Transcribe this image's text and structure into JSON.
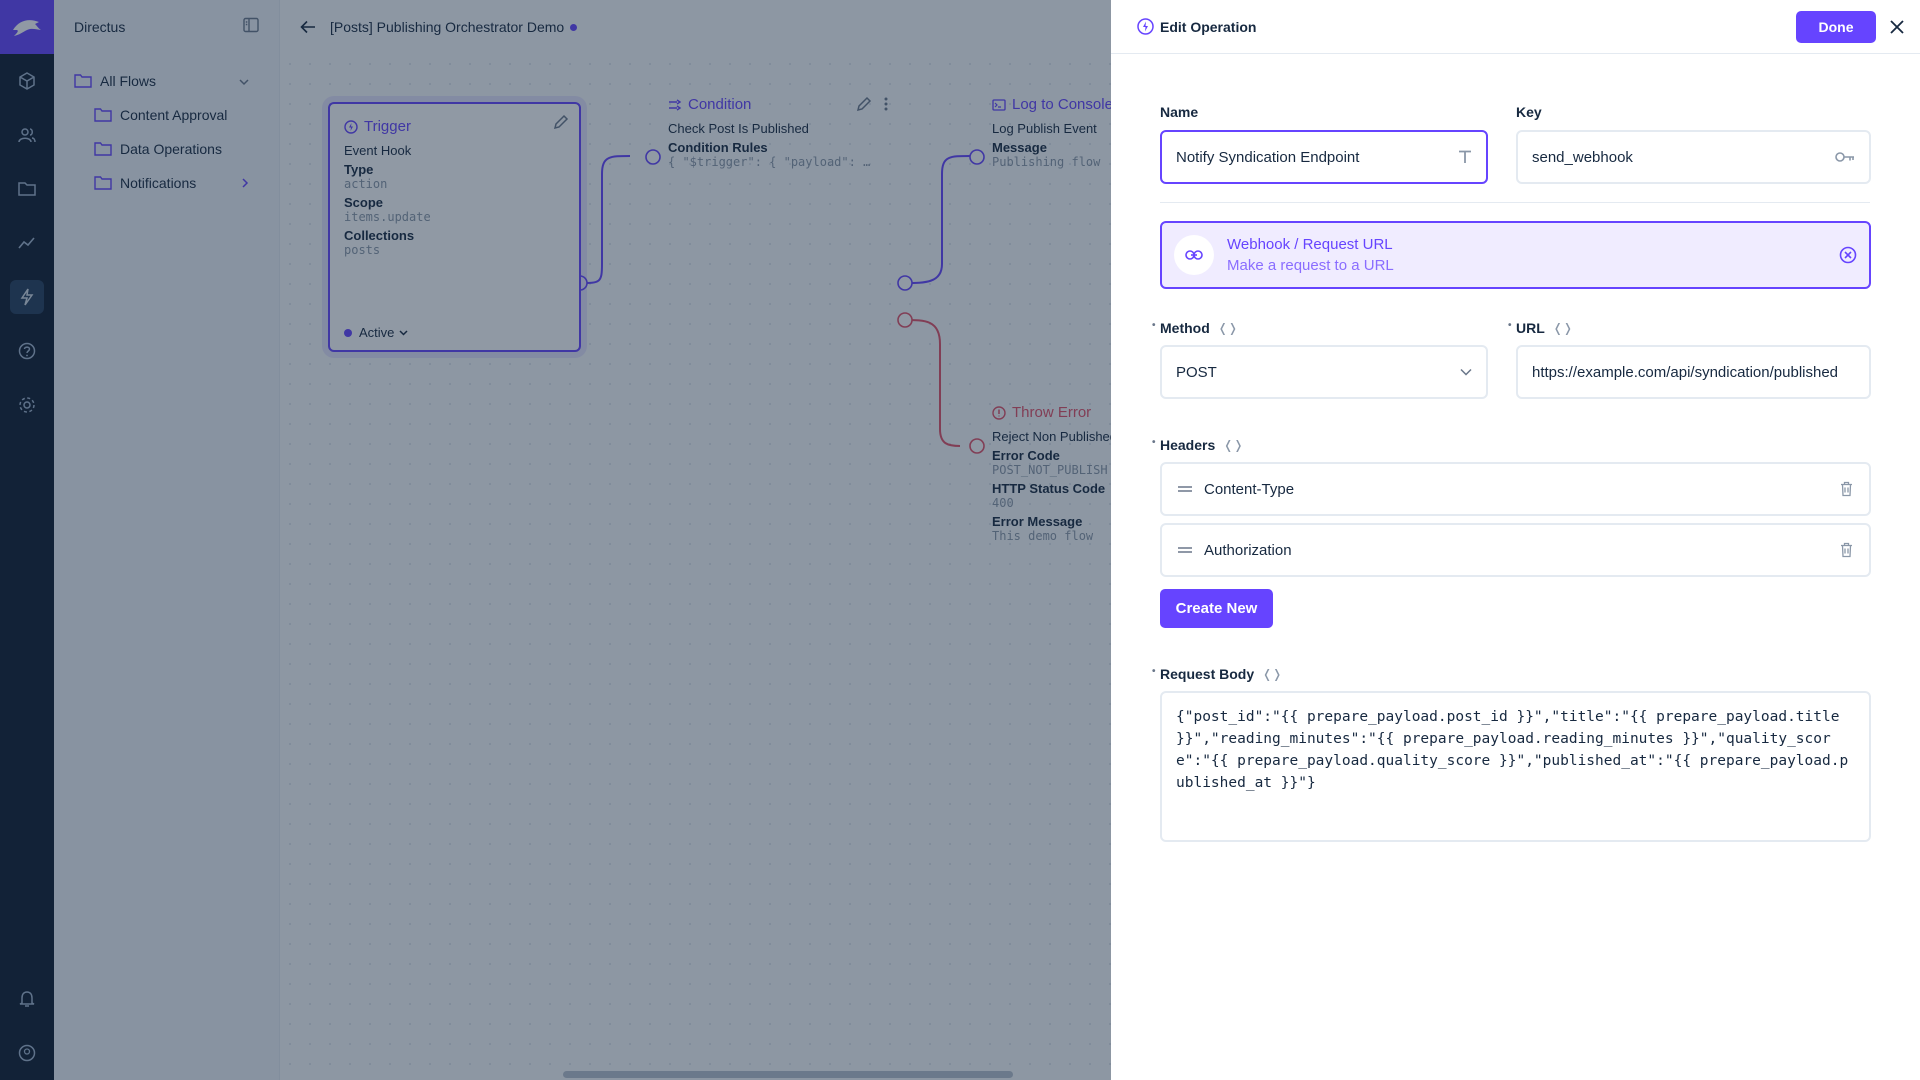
{
  "nav": {
    "title": "Directus",
    "items": [
      {
        "label": "All Flows"
      },
      {
        "label": "Content Approval"
      },
      {
        "label": "Data Operations"
      },
      {
        "label": "Notifications"
      }
    ]
  },
  "header": {
    "title": "[Posts] Publishing Orchestrator Demo"
  },
  "canvas": {
    "trigger": {
      "title": "Trigger",
      "subtitle": "Event Hook",
      "type_label": "Type",
      "type_value": "action",
      "scope_label": "Scope",
      "scope_value": "items.update",
      "collections_label": "Collections",
      "collections_value": "posts",
      "status": "Active"
    },
    "condition": {
      "title": "Condition",
      "name": "Check Post Is Published",
      "rules_label": "Condition Rules",
      "rules_value": "{ \"$trigger\": { \"payload\": …"
    },
    "log": {
      "title": "Log to Console",
      "name": "Log Publish Event",
      "message_label": "Message",
      "message_value": "Publishing flow"
    },
    "throw": {
      "title": "Throw Error",
      "name": "Reject Non Published",
      "code_label": "Error Code",
      "code_value": "POST_NOT_PUBLISH",
      "status_label": "HTTP Status Code",
      "status_value": "400",
      "message_label": "Error Message",
      "message_value": "This demo flow"
    }
  },
  "drawer": {
    "title": "Edit Operation",
    "done_label": "Done",
    "name_label": "Name",
    "name_value": "Notify Syndication Endpoint",
    "key_label": "Key",
    "key_value": "send_webhook",
    "operation": {
      "name": "Webhook / Request URL",
      "description": "Make a request to a URL"
    },
    "method_label": "Method",
    "method_value": "POST",
    "url_label": "URL",
    "url_value": "https://example.com/api/syndication/published",
    "headers_label": "Headers",
    "headers": [
      {
        "label": "Content-Type"
      },
      {
        "label": "Authorization"
      }
    ],
    "create_new_label": "Create New",
    "body_label": "Request Body",
    "body_value": "{\"post_id\":\"{{ prepare_payload.post_id }}\",\"title\":\"{{ prepare_payload.title }}\",\"reading_minutes\":\"{{ prepare_payload.reading_minutes }}\",\"quality_score\":\"{{ prepare_payload.quality_score }}\",\"published_at\":\"{{ prepare_payload.published_at }}\"}"
  },
  "colors": {
    "accent": "#6644ff",
    "module_bar": "#0e1c2f",
    "danger": "#e35169"
  }
}
